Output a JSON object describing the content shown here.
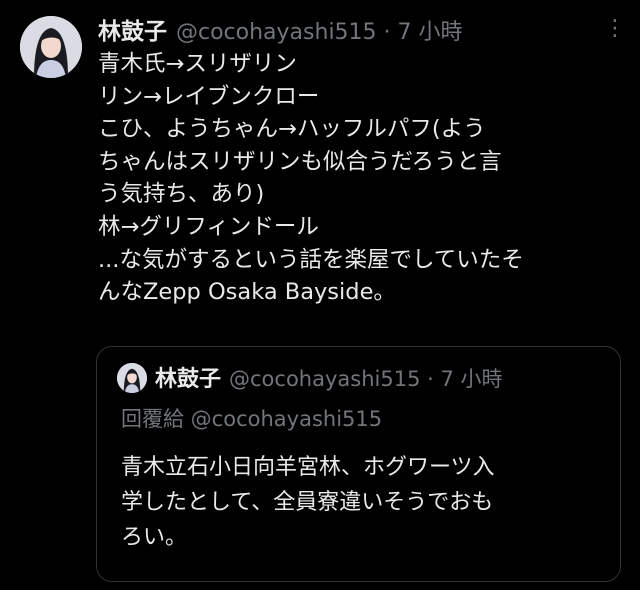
{
  "tweet": {
    "author_name": "林鼓子",
    "handle_time": "@cocohayashi515 · 7 小時",
    "more_icon": "more-vertical-icon",
    "lines": [
      "青木氏→スリザリン",
      "リン→レイブンクロー",
      "こひ、ようちゃん→ハッフルパフ(よう",
      "ちゃんはスリザリンも似合うだろうと言",
      "う気持ち、あり)",
      "林→グリフィンドール",
      "...な気がするという話を楽屋でしていたそ",
      "んなZepp Osaka Bayside。"
    ]
  },
  "quote": {
    "author_name": "林鼓子",
    "handle_time": "@cocohayashi515 · 7 小時",
    "reply_to": "回覆給 @cocohayashi515",
    "lines": [
      "青木立石小日向羊宮林、ホグワーツ入",
      "学したとして、全員寮違いそうでおも",
      "ろい。"
    ]
  }
}
